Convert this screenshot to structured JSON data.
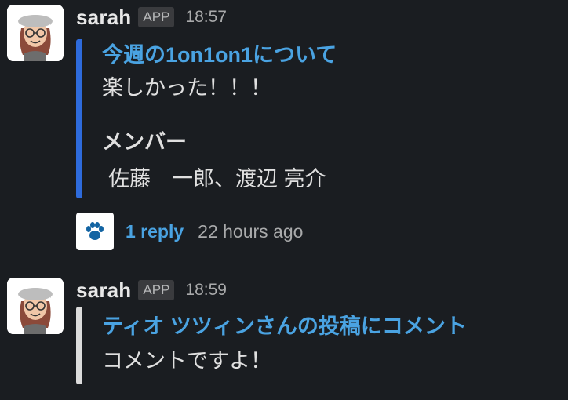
{
  "messages": [
    {
      "sender": "sarah",
      "badge": "APP",
      "time": "18:57",
      "attachment": {
        "title": "今週の1on1on1について",
        "text": "楽しかった！！！",
        "field_title": "メンバー",
        "field_value": "佐藤　一郎、渡辺 亮介",
        "bar_color": "#2e6bdc"
      },
      "thread": {
        "replies": "1 reply",
        "last_reply": "22 hours ago",
        "icon": "paw-icon"
      }
    },
    {
      "sender": "sarah",
      "badge": "APP",
      "time": "18:59",
      "attachment": {
        "title": "ティオ ツツィンさんの投稿にコメント",
        "text": "コメントですよ！",
        "bar_color": "#dcdcdc"
      }
    }
  ],
  "colors": {
    "background": "#1a1d21",
    "link": "#4aa3e2",
    "accent_bar": "#2e6bdc"
  }
}
